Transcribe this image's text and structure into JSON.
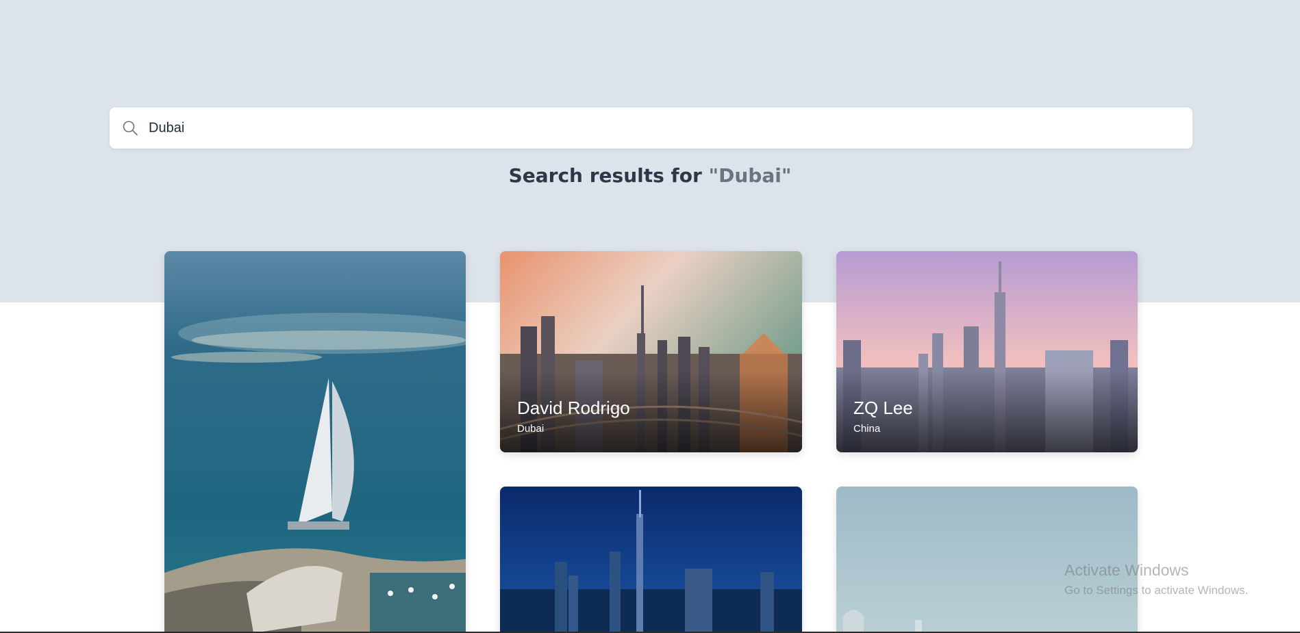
{
  "search": {
    "value": "Dubai",
    "icon": "search-icon"
  },
  "results": {
    "prefix": "Search results for ",
    "query": "\"Dubai\""
  },
  "cards": [
    {
      "name": "",
      "location": "",
      "image": "burj-al-arab-aerial-photo"
    },
    {
      "name": "David Rodrigo",
      "location": "Dubai",
      "image": "dubai-skyline-sunset-photo"
    },
    {
      "name": "ZQ Lee",
      "location": "China",
      "image": "dubai-skyline-pink-sky-photo"
    },
    {
      "name": "",
      "location": "",
      "image": "dubai-skyline-night-photo"
    },
    {
      "name": "",
      "location": "",
      "image": "city-pale-sky-photo"
    }
  ],
  "watermark": {
    "title": "Activate Windows",
    "subtitle": "Go to Settings to activate Windows."
  },
  "colors": {
    "hero_background": "#dde3eb",
    "heading": "#2d3748",
    "query_text": "#6b7280"
  }
}
